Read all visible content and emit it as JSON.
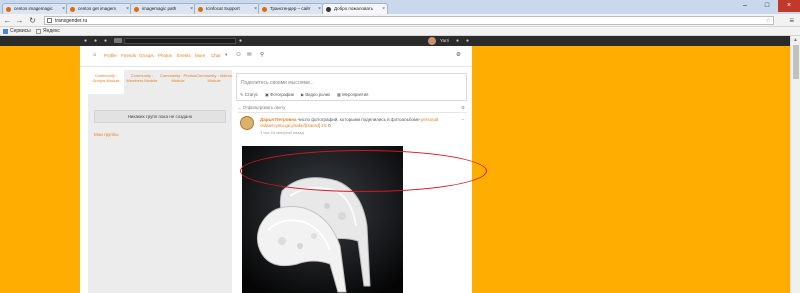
{
  "browser": {
    "tabs": [
      {
        "title": "centos imagemagic",
        "active": false
      },
      {
        "title": "centos get imagem",
        "active": false
      },
      {
        "title": "imagemagic path",
        "active": false
      },
      {
        "title": "Icinfocat Support",
        "active": false
      },
      {
        "title": "Трансгендер – сайт",
        "active": false
      },
      {
        "title": "Добро пожаловать",
        "active": true
      }
    ],
    "url": "transgender.ru",
    "bookmarks": [
      "Сервисы",
      "Яндекс"
    ],
    "accent_color": "#ffae00"
  },
  "site": {
    "topbar": {
      "username": "Yarri"
    },
    "nav": [
      "Profile",
      "Friends",
      "Groups",
      "Photos",
      "Events",
      "More",
      "Chat"
    ],
    "sidebar": {
      "tabs": [
        {
          "label": "Community : Groups Module",
          "active": true
        },
        {
          "label": "Community : Members Module",
          "active": false
        },
        {
          "label": "Community : Photos Module",
          "active": false
        },
        {
          "label": "Community : Videos Module",
          "active": false
        }
      ],
      "empty_groups": "Никаких групп пока не создано",
      "link": "Мои группы"
    },
    "post_box": {
      "placeholder": "Поделитесь своими мыслями...",
      "actions": [
        "Статус",
        "Фотографии",
        "Видео ролик",
        "Мероприятия"
      ]
    },
    "feed": {
      "header": "Отфильтровать ленту",
      "item": {
        "author": "Дарья Петровна",
        "text_before": "число фотографий, которыми поделились в фотоальбоме",
        "album": "personal",
        "path": "onlaie/cyetu.ga.jmake/)tsaerd[ 1S",
        "counter": "0",
        "time": "1 час 15 минутой назад"
      }
    }
  }
}
